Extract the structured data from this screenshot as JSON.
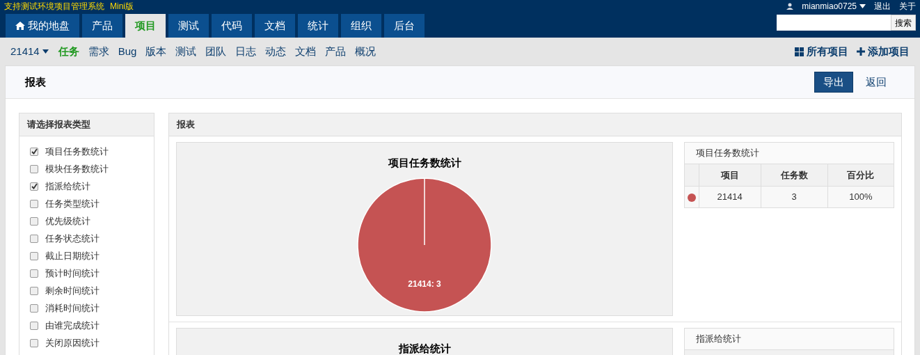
{
  "header": {
    "title": "支持测试环境项目管理系统",
    "edition": "Mini版",
    "user": "mianmiao0725",
    "links": [
      "退出",
      "关于"
    ],
    "search": {
      "button": "搜索"
    }
  },
  "main_nav": [
    {
      "label": "我的地盘",
      "selected": false
    },
    {
      "label": "产品",
      "selected": false
    },
    {
      "label": "项目",
      "selected": true
    },
    {
      "label": "测试",
      "selected": false
    },
    {
      "label": "代码",
      "selected": false
    },
    {
      "label": "文档",
      "selected": false
    },
    {
      "label": "统计",
      "selected": false
    },
    {
      "label": "组织",
      "selected": false
    },
    {
      "label": "后台",
      "selected": false
    }
  ],
  "sub_nav": {
    "project": "21414",
    "items": [
      {
        "label": "任务",
        "selected": true
      },
      {
        "label": "需求",
        "selected": false
      },
      {
        "label": "Bug",
        "selected": false
      },
      {
        "label": "版本",
        "selected": false
      },
      {
        "label": "测试",
        "selected": false
      },
      {
        "label": "团队",
        "selected": false
      },
      {
        "label": "日志",
        "selected": false
      },
      {
        "label": "动态",
        "selected": false
      },
      {
        "label": "文档",
        "selected": false
      },
      {
        "label": "产品",
        "selected": false
      },
      {
        "label": "概况",
        "selected": false
      }
    ],
    "actions": [
      {
        "label": "所有项目",
        "kind": "grid"
      },
      {
        "label": "添加项目",
        "kind": "plus"
      }
    ]
  },
  "page": {
    "title": "报表",
    "buttons": [
      {
        "label": "导出",
        "kind": "primary"
      },
      {
        "label": "返回",
        "kind": "link"
      }
    ]
  },
  "report_types": {
    "title": "请选择报表类型",
    "items": [
      {
        "label": "项目任务数统计",
        "checked": true
      },
      {
        "label": "模块任务数统计",
        "checked": false
      },
      {
        "label": "指派给统计",
        "checked": true
      },
      {
        "label": "任务类型统计",
        "checked": false
      },
      {
        "label": "优先级统计",
        "checked": false
      },
      {
        "label": "任务状态统计",
        "checked": false
      },
      {
        "label": "截止日期统计",
        "checked": false
      },
      {
        "label": "预计时间统计",
        "checked": false
      },
      {
        "label": "剩余时间统计",
        "checked": false
      },
      {
        "label": "消耗时间统计",
        "checked": false
      },
      {
        "label": "由谁完成统计",
        "checked": false
      },
      {
        "label": "关闭原因统计",
        "checked": false
      }
    ]
  },
  "report": {
    "title": "报表",
    "sections": [
      {
        "chart_data": {
          "type": "pie",
          "title": "项目任务数统计",
          "series": [
            {
              "color": "#c55353",
              "values": [
                100
              ]
            }
          ],
          "value_labels": [
            "21414: 3"
          ]
        },
        "table": {
          "title": "项目任务数统计",
          "columns": [
            "项目",
            "任务数",
            "百分比"
          ],
          "rows": [
            {
              "color": "#c55353",
              "cells": [
                "21414",
                "3",
                "100%"
              ]
            }
          ]
        }
      },
      {
        "chart_title": "指派给统计",
        "table": {
          "title": "指派给统计"
        }
      }
    ]
  }
}
